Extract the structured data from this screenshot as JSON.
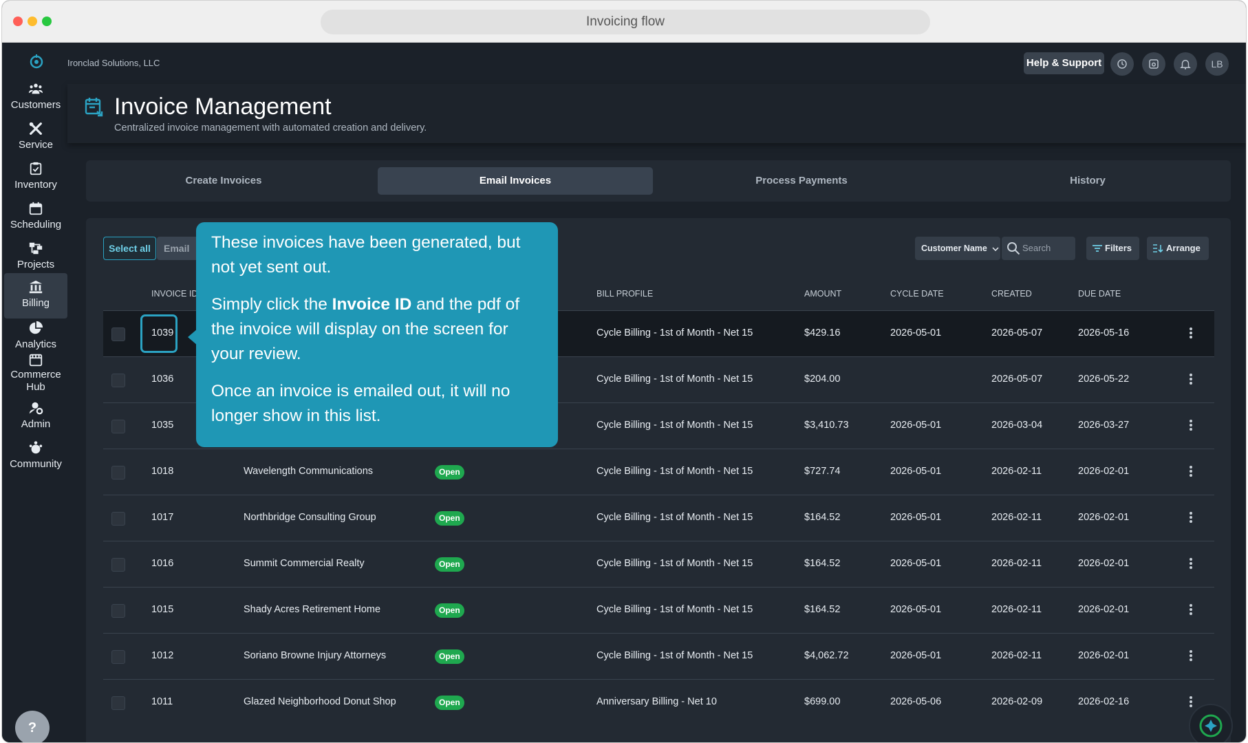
{
  "window": {
    "title": "Invoicing flow"
  },
  "company": "Ironclad Solutions, LLC",
  "topbar": {
    "help_label": "Help & Support",
    "avatar_initials": "LB"
  },
  "sidebar": {
    "items": [
      {
        "label": "Customers",
        "icon": "customers-icon"
      },
      {
        "label": "Service",
        "icon": "service-icon"
      },
      {
        "label": "Inventory",
        "icon": "inventory-icon"
      },
      {
        "label": "Scheduling",
        "icon": "calendar-icon"
      },
      {
        "label": "Projects",
        "icon": "projects-icon"
      },
      {
        "label": "Billing",
        "icon": "bank-icon",
        "active": true
      },
      {
        "label": "Analytics",
        "icon": "pie-chart-icon"
      },
      {
        "label": "Commerce Hub",
        "icon": "store-icon"
      },
      {
        "label": "Admin",
        "icon": "admin-icon"
      },
      {
        "label": "Community",
        "icon": "community-icon"
      }
    ],
    "help_glyph": "?"
  },
  "header": {
    "title": "Invoice Management",
    "subtitle": "Centralized invoice management with automated creation and delivery."
  },
  "tabs": [
    {
      "label": "Create Invoices"
    },
    {
      "label": "Email Invoices",
      "active": true
    },
    {
      "label": "Process Payments"
    },
    {
      "label": "History"
    }
  ],
  "toolbar": {
    "select_all": "Select all",
    "email_partial": "Email",
    "sort_field": "Customer Name",
    "search_placeholder": "Search",
    "filters": "Filters",
    "arrange": "Arrange"
  },
  "table": {
    "columns": {
      "invoice_id": "INVOICE ID",
      "bill_profile": "BILL PROFILE",
      "amount": "AMOUNT",
      "cycle_date": "CYCLE DATE",
      "created": "CREATED",
      "due_date": "DUE DATE"
    },
    "rows": [
      {
        "id": "1039",
        "customer": "",
        "status": "",
        "profile": "Cycle Billing - 1st of Month - Net 15",
        "amount": "$429.16",
        "cycle": "2026-05-01",
        "created": "2026-05-07",
        "due": "2026-05-16"
      },
      {
        "id": "1036",
        "customer": "",
        "status": "",
        "profile": "Cycle Billing - 1st of Month - Net 15",
        "amount": "$204.00",
        "cycle": "",
        "created": "2026-05-07",
        "due": "2026-05-22"
      },
      {
        "id": "1035",
        "customer": "",
        "status": "",
        "profile": "Cycle Billing - 1st of Month - Net 15",
        "amount": "$3,410.73",
        "cycle": "2026-05-01",
        "created": "2026-03-04",
        "due": "2026-03-27"
      },
      {
        "id": "1018",
        "customer": "Wavelength Communications",
        "status": "Open",
        "profile": "Cycle Billing - 1st of Month - Net 15",
        "amount": "$727.74",
        "cycle": "2026-05-01",
        "created": "2026-02-11",
        "due": "2026-02-01"
      },
      {
        "id": "1017",
        "customer": "Northbridge Consulting Group",
        "status": "Open",
        "profile": "Cycle Billing - 1st of Month - Net 15",
        "amount": "$164.52",
        "cycle": "2026-05-01",
        "created": "2026-02-11",
        "due": "2026-02-01"
      },
      {
        "id": "1016",
        "customer": "Summit Commercial Realty",
        "status": "Open",
        "profile": "Cycle Billing - 1st of Month - Net 15",
        "amount": "$164.52",
        "cycle": "2026-05-01",
        "created": "2026-02-11",
        "due": "2026-02-01"
      },
      {
        "id": "1015",
        "customer": "Shady Acres Retirement Home",
        "status": "Open",
        "profile": "Cycle Billing - 1st of Month - Net 15",
        "amount": "$164.52",
        "cycle": "2026-05-01",
        "created": "2026-02-11",
        "due": "2026-02-01"
      },
      {
        "id": "1012",
        "customer": "Soriano Browne Injury Attorneys",
        "status": "Open",
        "profile": "Cycle Billing - 1st of Month - Net 15",
        "amount": "$4,062.72",
        "cycle": "2026-05-01",
        "created": "2026-02-11",
        "due": "2026-02-01"
      },
      {
        "id": "1011",
        "customer": "Glazed Neighborhood Donut Shop",
        "status": "Open",
        "profile": "Anniversary Billing - Net 10",
        "amount": "$699.00",
        "cycle": "2026-05-06",
        "created": "2026-02-09",
        "due": "2026-02-16"
      }
    ]
  },
  "tooltip": {
    "p1": "These invoices have been generated, but not yet sent out.",
    "p2_before": "Simply click the ",
    "p2_bold": "Invoice ID",
    "p2_after": " and the pdf of the invoice will display on the screen for your review.",
    "p3": "Once an invoice is emailed out, it will no longer show in this list."
  },
  "colors": {
    "accent": "#1f97b5",
    "status_open": "#1fa84f",
    "background": "#1b2129"
  }
}
